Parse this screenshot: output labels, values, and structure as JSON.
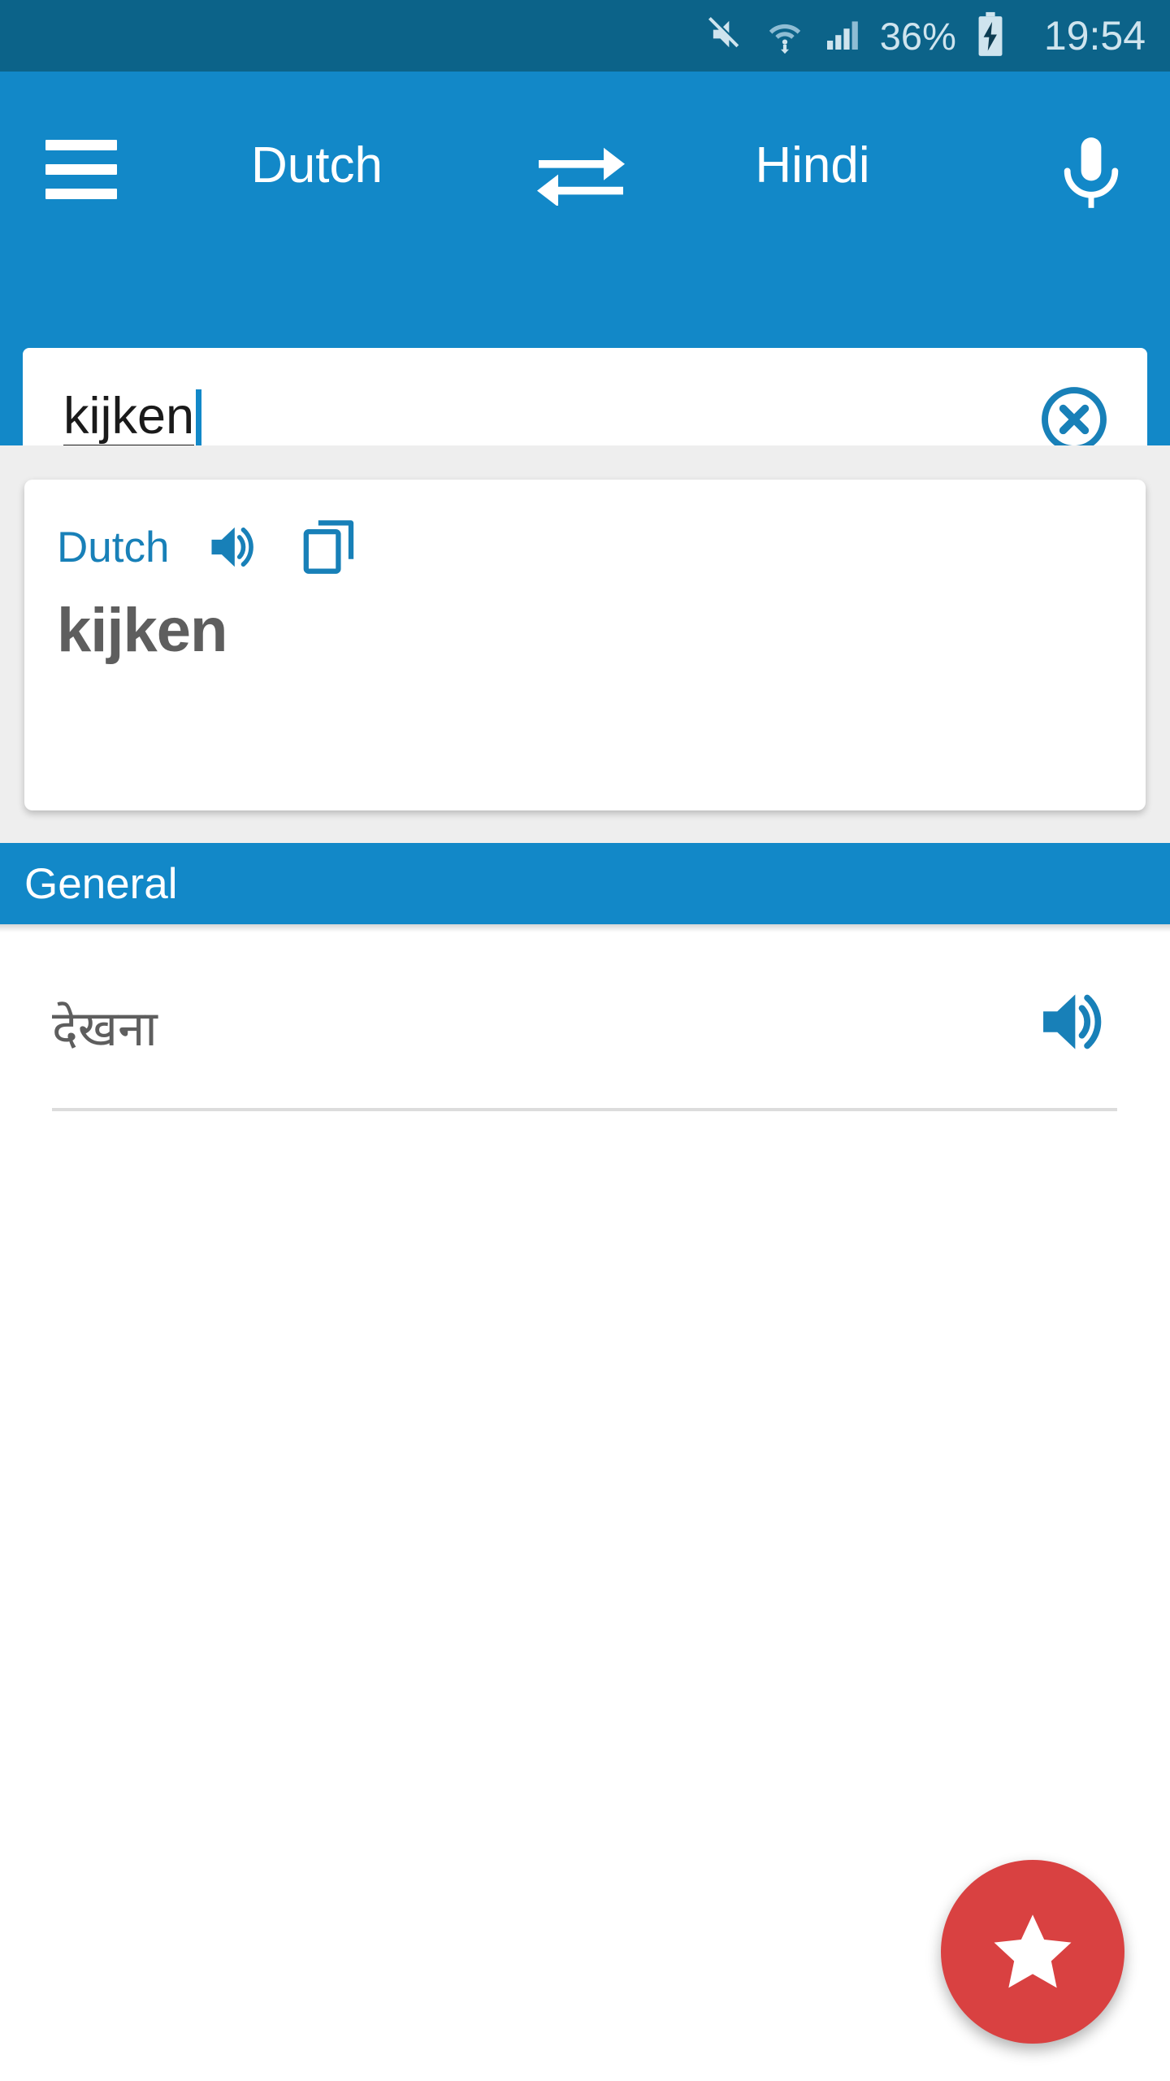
{
  "statusbar": {
    "battery_percent": "36%",
    "clock": "19:54",
    "icons": [
      "mute-icon",
      "wifi-icon",
      "signal-icon",
      "battery-charging-icon"
    ],
    "background_color": "#0c6389",
    "text_color": "#cfe4ee"
  },
  "toolbar": {
    "menu_label": "menu",
    "source_language": "Dutch",
    "target_language": "Hindi",
    "swap_label": "swap-languages",
    "mic_label": "voice-input",
    "background_color": "#1288c8"
  },
  "search": {
    "value": "kijken",
    "placeholder": "",
    "clear_label": "clear"
  },
  "card": {
    "language": "Dutch",
    "word": "kijken",
    "speak_label": "pronounce",
    "copy_label": "copy"
  },
  "section": {
    "title": "General"
  },
  "results": [
    {
      "word": "देखना",
      "speak_label": "pronounce"
    }
  ],
  "fab": {
    "label": "favorites",
    "icon": "star-icon",
    "color": "#dd4murky"
  },
  "colors": {
    "accent_blue": "#1288c8",
    "dark_blue": "#0c6389",
    "link_blue": "#1880b8",
    "text_gray": "#5e5e5e",
    "fab_red": "#d94141",
    "page_gray": "#eeeeee",
    "divider": "#dcdcdc"
  }
}
